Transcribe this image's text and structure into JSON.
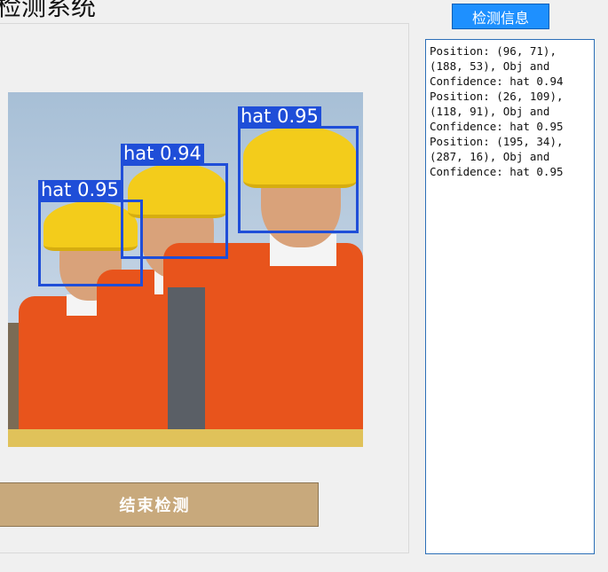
{
  "window": {
    "title": "检测系统"
  },
  "detection_panel": {
    "image_alt": "construction workers wearing yellow hard hats",
    "detections": [
      {
        "class": "hat",
        "confidence": "0.95",
        "label": "hat 0.95"
      },
      {
        "class": "hat",
        "confidence": "0.94",
        "label": "hat 0.94"
      },
      {
        "class": "hat",
        "confidence": "0.95",
        "label": "hat 0.95"
      }
    ],
    "end_button_label": "结束检测"
  },
  "info_panel": {
    "header": "检测信息",
    "log_text": "Position: (96, 71),\n(188, 53), Obj and\nConfidence: hat 0.94\nPosition: (26, 109),\n(118, 91), Obj and\nConfidence: hat 0.95\nPosition: (195, 34),\n(287, 16), Obj and\nConfidence: hat 0.95"
  },
  "colors": {
    "box": "#1f4ed8",
    "button": "#c8a97c",
    "header": "#1e90ff",
    "helmet": "#f3cc1b",
    "jacket": "#e8541c"
  }
}
